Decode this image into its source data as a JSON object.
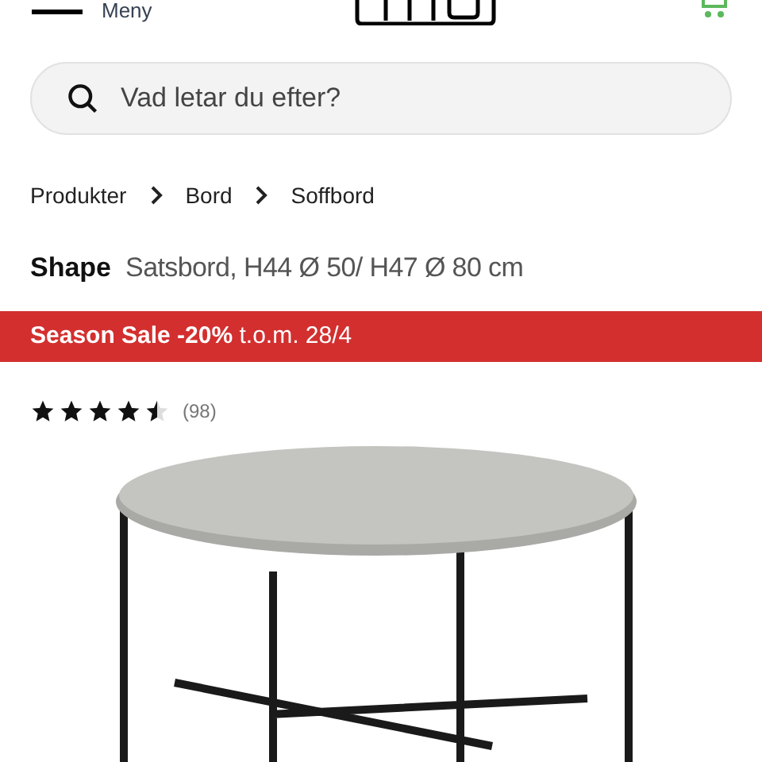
{
  "header": {
    "menu_label": "Meny"
  },
  "search": {
    "placeholder": "Vad letar du efter?"
  },
  "breadcrumb": [
    "Produkter",
    "Bord",
    "Soffbord"
  ],
  "product": {
    "brand": "Shape",
    "name": "Satsbord, H44 Ø 50/ H47 Ø 80 cm"
  },
  "banner": {
    "text": "**Season Sale -20%** t.o.m. 28/4"
  },
  "rating": {
    "stars": 4.5,
    "count": "(98)"
  }
}
